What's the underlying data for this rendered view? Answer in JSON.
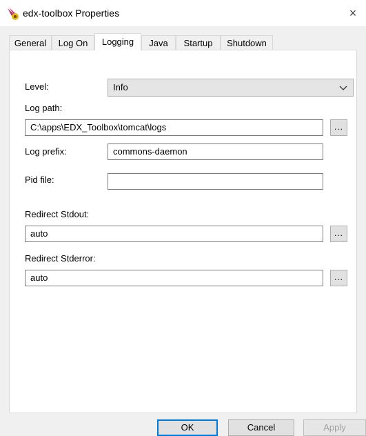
{
  "window": {
    "title": "edx-toolbox Properties",
    "close_glyph": "×",
    "icon": "service-app-icon"
  },
  "tabs": [
    {
      "label": "General"
    },
    {
      "label": "Log On"
    },
    {
      "label": "Logging",
      "active": true
    },
    {
      "label": "Java"
    },
    {
      "label": "Startup"
    },
    {
      "label": "Shutdown"
    }
  ],
  "logging": {
    "level_label": "Level:",
    "level_value": "Info",
    "log_path_label": "Log path:",
    "log_path_value": "C:\\apps\\EDX_Toolbox\\tomcat\\logs",
    "log_prefix_label": "Log prefix:",
    "log_prefix_value": "commons-daemon",
    "pid_file_label": "Pid file:",
    "pid_file_value": "",
    "redirect_stdout_label": "Redirect Stdout:",
    "redirect_stdout_value": "auto",
    "redirect_stderror_label": "Redirect Stderror:",
    "redirect_stderror_value": "auto",
    "browse_label": "..."
  },
  "buttons": {
    "ok": "OK",
    "cancel": "Cancel",
    "apply": "Apply"
  },
  "colors": {
    "accent": "#0078d7",
    "panel": "#ffffff",
    "dialog": "#f0f0f0"
  }
}
